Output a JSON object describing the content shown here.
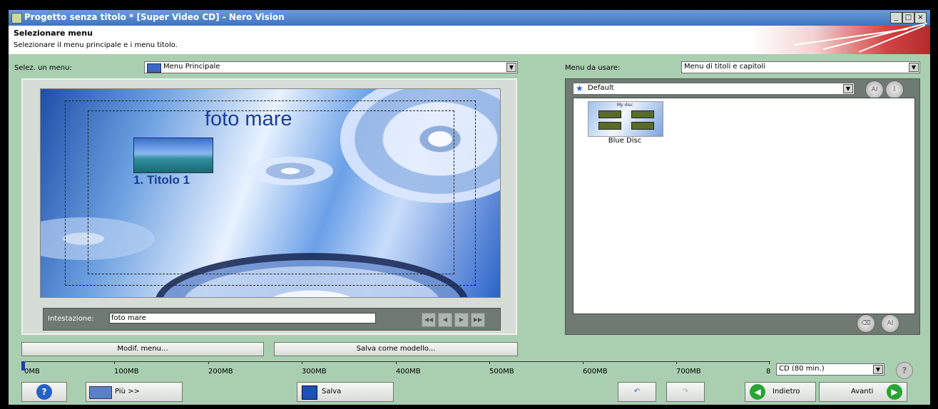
{
  "window": {
    "title": "Progetto senza titolo * [Super Video CD] - Nero Vision",
    "min_label": "_",
    "max_label": "□",
    "close_label": "×"
  },
  "header": {
    "title": "Selezionare menu",
    "subtitle": "Selezionare il menu principale e i menu titolo."
  },
  "left": {
    "select_label": "Selez. un menu:",
    "select_value": "Menu Principale",
    "preview": {
      "title": "foto mare",
      "item_label": "1. Titolo 1"
    },
    "heading_label": "Intestazione:",
    "heading_value": "foto mare",
    "edit_button": "Modif. menu...",
    "save_template_button": "Salva come modello..."
  },
  "right": {
    "select_label": "Menu da usare:",
    "select_value": "Menu di titoli e capitoli",
    "style_value": "Default",
    "templates": [
      {
        "name": "Blue Disc",
        "thumb_caption": "My disc"
      }
    ]
  },
  "ruler": {
    "labels": [
      "0MB",
      "100MB",
      "200MB",
      "300MB",
      "400MB",
      "500MB",
      "600MB",
      "700MB",
      "8"
    ],
    "disc_value": "CD (80 min.)"
  },
  "footer": {
    "help": "?",
    "more_button": "Più >>",
    "save_button": "Salva",
    "back_button": "Indietro",
    "next_button": "Avanti"
  },
  "colors": {
    "window_bg": "#a9cfb0",
    "title_bar": "#4a7fc8",
    "accent_green": "#2aa335",
    "help_blue": "#2461c8"
  }
}
